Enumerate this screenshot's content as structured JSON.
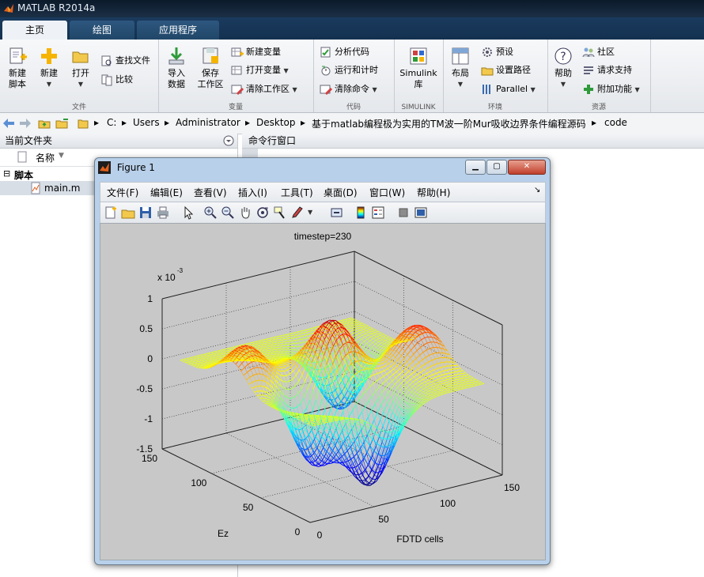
{
  "app": {
    "title": "MATLAB R2014a"
  },
  "tabs": [
    {
      "label": "主页"
    },
    {
      "label": "绘图"
    },
    {
      "label": "应用程序"
    }
  ],
  "ribbon": {
    "new_script": [
      "新建",
      "脚本"
    ],
    "new": "新建",
    "open": "打开",
    "find_files": "查找文件",
    "compare": "比较",
    "group_file": "文件",
    "import": [
      "导入",
      "数据"
    ],
    "save_ws": [
      "保存",
      "工作区"
    ],
    "new_var": "新建变量",
    "open_var": "打开变量",
    "clear_ws": "清除工作区",
    "group_var": "变量",
    "analyze": "分析代码",
    "run_time": "运行和计时",
    "clear_cmd": "清除命令",
    "group_code": "代码",
    "simulink": [
      "Simulink",
      "库"
    ],
    "group_simulink": "SIMULINK",
    "layout": "布局",
    "prefs": "预设",
    "set_path": "设置路径",
    "parallel": "Parallel",
    "group_env": "环境",
    "help": "帮助",
    "community": "社区",
    "support": "请求支持",
    "addons": "附加功能",
    "group_res": "资源"
  },
  "address": {
    "parts": [
      "C:",
      "Users",
      "Administrator",
      "Desktop",
      "基于matlab编程极为实用的TM波一阶Mur吸收边界条件编程源码",
      "code"
    ]
  },
  "current_folder": {
    "title": "当前文件夹",
    "col_name": "名称",
    "section": "脚本",
    "file": "main.m"
  },
  "command_window": {
    "title": "命令行窗口"
  },
  "figure": {
    "title": "Figure 1",
    "menus": [
      "文件(F)",
      "编辑(E)",
      "查看(V)",
      "插入(I)",
      "工具(T)",
      "桌面(D)",
      "窗口(W)",
      "帮助(H)"
    ]
  },
  "chart_data": {
    "type": "surface",
    "title": "timestep=230",
    "xlabel": "FDTD cells",
    "ylabel": "Ez",
    "zlabel": "",
    "z_multiplier": "x 10",
    "z_exponent": "-3",
    "xticks": [
      0,
      50,
      100,
      150
    ],
    "yticks": [
      0,
      50,
      100,
      150
    ],
    "zticks": [
      -1.5,
      -1,
      -0.5,
      0,
      0.5,
      1
    ],
    "xlim": [
      0,
      150
    ],
    "ylim": [
      0,
      150
    ],
    "zlim": [
      -1.5,
      1
    ],
    "colormap": "jet",
    "grid": "on",
    "peaks": [
      {
        "x": 75,
        "y": 75,
        "z": 0.95
      },
      {
        "x": 20,
        "y": 90,
        "z": 0.6
      },
      {
        "x": 130,
        "y": 60,
        "z": 0.6
      }
    ],
    "troughs": [
      {
        "x": 70,
        "y": 30,
        "z": -1.45
      },
      {
        "x": 45,
        "y": 55,
        "z": -1.2
      },
      {
        "x": 100,
        "y": 100,
        "z": -1.0
      }
    ]
  }
}
